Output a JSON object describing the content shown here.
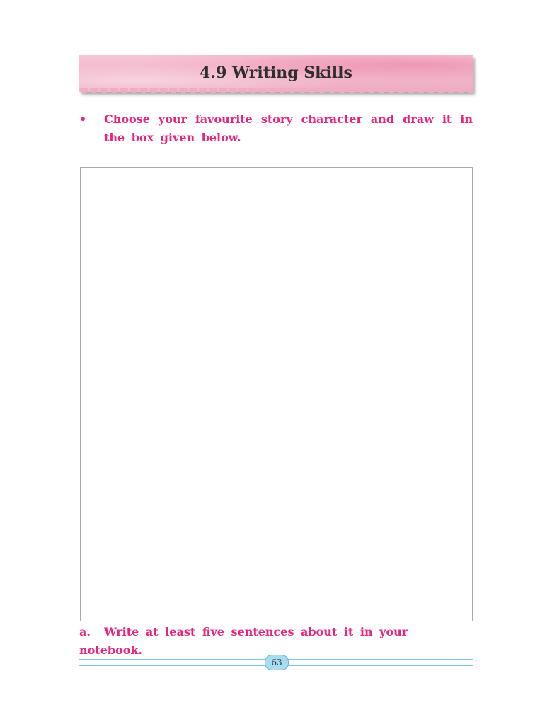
{
  "section": {
    "title": "4.9 Writing Skills"
  },
  "instruction": {
    "bullet": "•",
    "text": "Choose your favourite story character and draw it in the box given below."
  },
  "question": {
    "letter": "a.",
    "text": "Write at least five sentences about it in your notebook."
  },
  "footer": {
    "page_number": "63"
  },
  "colors": {
    "text_accent": "#e4277b",
    "banner": "#f2b4c8",
    "footer_rule": "#7ec8e3"
  }
}
